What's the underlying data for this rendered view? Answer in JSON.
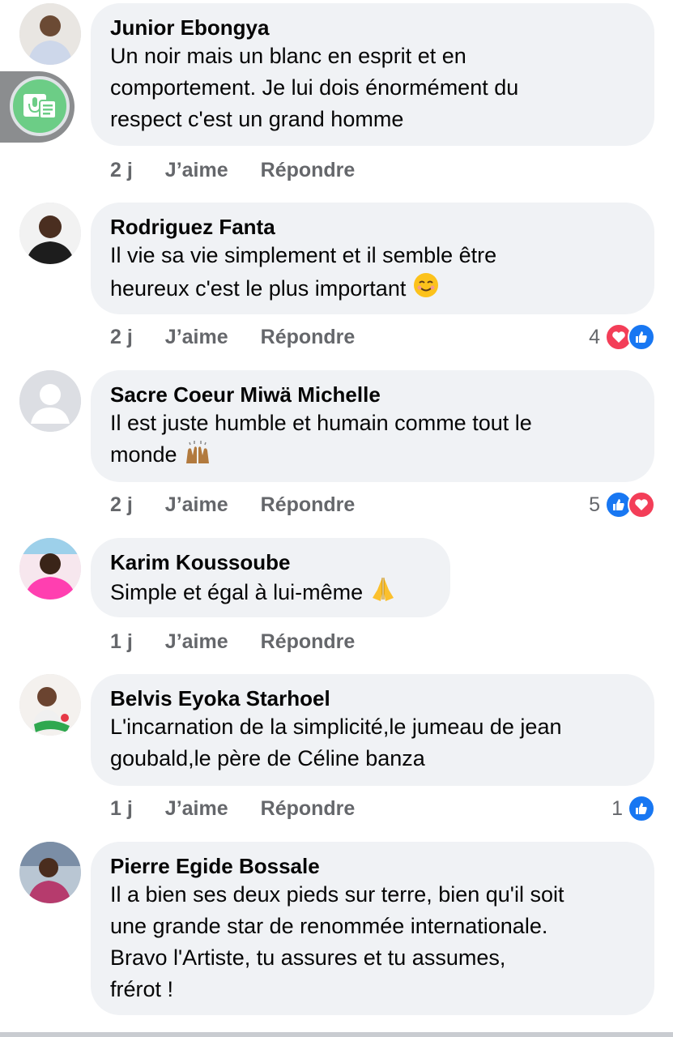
{
  "comments": [
    {
      "author": "Junior Ebongya",
      "text": "Un noir mais un blanc en esprit et en\ncomportement. Je lui dois énormément du\nrespect c'est un grand homme",
      "time": "2 j",
      "like": "J’aime",
      "reply": "Répondre",
      "reaction_count": ""
    },
    {
      "author": "Rodriguez Fanta",
      "text": "Il vie sa vie simplement et il semble être\nheureux c'est le plus important ",
      "time": "2 j",
      "like": "J’aime",
      "reply": "Répondre",
      "reaction_count": "4"
    },
    {
      "author": "Sacre Coeur Miwä Michelle",
      "text": "Il est juste humble et humain comme tout le\nmonde ",
      "time": "2 j",
      "like": "J’aime",
      "reply": "Répondre",
      "reaction_count": "5"
    },
    {
      "author": "Karim Koussoube",
      "text": "Simple et égal à lui-même ",
      "time": "1 j",
      "like": "J’aime",
      "reply": "Répondre",
      "reaction_count": ""
    },
    {
      "author": "Belvis Eyoka Starhoel",
      "text": "L'incarnation de la simplicité,le jumeau de jean\ngoubald,le père de Céline banza",
      "time": "1 j",
      "like": "J’aime",
      "reply": "Répondre",
      "reaction_count": "1"
    },
    {
      "author": "Pierre Egide Bossale",
      "text": "Il a bien ses deux pieds sur terre, bien qu'il soit\nune grande star de renommée internationale.\nBravo l'Artiste, tu assures et tu assumes,\nfrérot !",
      "time": "",
      "like": "",
      "reply": "",
      "reaction_count": ""
    }
  ],
  "colors": {
    "bubble": "#f0f2f5",
    "like": "#1877f2",
    "love": "#f33e58",
    "meta": "#65676b"
  },
  "icons": {
    "voice_button": "voice-to-text-icon",
    "like_reaction": "like-reaction-icon",
    "love_reaction": "love-reaction-icon"
  }
}
